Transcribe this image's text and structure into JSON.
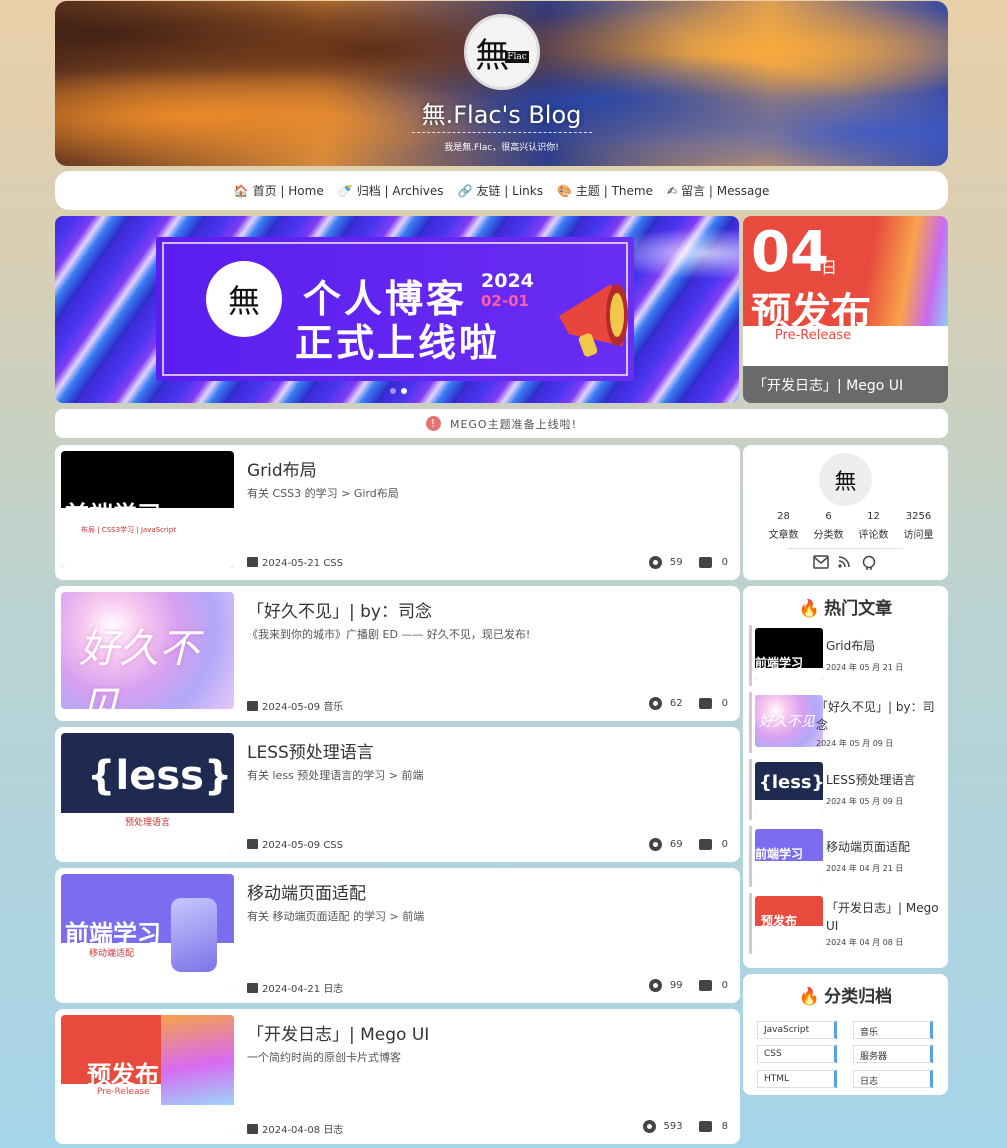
{
  "header": {
    "title": "無.Flac's Blog",
    "subtitle": "我是無.Flac，很高兴认识你!",
    "avatar_text": "無",
    "avatar_badge": "Flac"
  },
  "nav": [
    {
      "icon": "🏠",
      "label": "首页 | Home"
    },
    {
      "icon": "🍼",
      "label": "归档 | Archives"
    },
    {
      "icon": "🔗",
      "label": "友链 | Links"
    },
    {
      "icon": "🎨",
      "label": "主题 | Theme"
    },
    {
      "icon": "✍",
      "label": "留言 | Message"
    }
  ],
  "banner": {
    "logo": "無",
    "line1": "个人博客",
    "line2": "正式上线啦",
    "year": "2024",
    "date": "02-01"
  },
  "feature": {
    "day": "04",
    "day_unit": "日",
    "big": "预发布",
    "sub": "Pre-Release",
    "caption": "「开发日志」| Mego UI"
  },
  "notice": {
    "text": "MEGO主题准备上线啦!",
    "icon": "!"
  },
  "posts": [
    {
      "title": "Grid布局",
      "desc": "有关 CSS3 的学习 > Gird布局",
      "date": "2024-05-21",
      "cat": "CSS",
      "views": "59",
      "comments": "0",
      "thumb_text": "前端学习",
      "thumb_sub": "布局 | CSS3学习 | JavaScript"
    },
    {
      "title": "「好久不见」| by：司念",
      "desc": "《我来到你的城市》广播剧 ED —— 好久不见，现已发布!",
      "date": "2024-05-09",
      "cat": "音乐",
      "views": "62",
      "comments": "0",
      "thumb_text": "好久不见",
      "thumb_sub": ""
    },
    {
      "title": "LESS预处理语言",
      "desc": "有关 less 预处理语言的学习 > 前端",
      "date": "2024-05-09",
      "cat": "CSS",
      "views": "69",
      "comments": "0",
      "thumb_text": "{less}",
      "thumb_sub": "预处理语言"
    },
    {
      "title": "移动端页面适配",
      "desc": "有关 移动端页面适配 的学习 > 前端",
      "date": "2024-04-21",
      "cat": "日志",
      "views": "99",
      "comments": "0",
      "thumb_text": "前端学习",
      "thumb_sub": "移动端适配"
    },
    {
      "title": "「开发日志」| Mego UI",
      "desc": "一个简约时尚的原创卡片式博客",
      "date": "2024-04-08",
      "cat": "日志",
      "views": "593",
      "comments": "8",
      "thumb_text": "预发布",
      "thumb_sub": "Pre-Release"
    }
  ],
  "profile": {
    "avatar_text": "無",
    "stats": [
      {
        "num": "28",
        "label": "文章数"
      },
      {
        "num": "6",
        "label": "分类数"
      },
      {
        "num": "12",
        "label": "评论数"
      },
      {
        "num": "3256",
        "label": "访问量"
      }
    ],
    "icons": [
      "mail-icon",
      "rss-icon",
      "github-icon"
    ]
  },
  "hot": {
    "title": "热门文章",
    "items": [
      {
        "title": "Grid布局",
        "date": "2024 年 05 月 21 日",
        "thumb_text": "前端学习"
      },
      {
        "title": "「好久不见」| by：司念",
        "date": "2024 年 05 月 09 日",
        "thumb_text": "好久不见"
      },
      {
        "title": "LESS预处理语言",
        "date": "2024 年 05 月 09 日",
        "thumb_text": "{less}"
      },
      {
        "title": "移动端页面适配",
        "date": "2024 年 04 月 21 日",
        "thumb_text": "前端学习"
      },
      {
        "title": "「开发日志」| Mego UI",
        "date": "2024 年 04 月 08 日",
        "thumb_text": "预发布"
      }
    ]
  },
  "archive": {
    "title": "分类归档",
    "tags": [
      "JavaScript",
      "音乐",
      "CSS",
      "服务器",
      "HTML",
      "日志"
    ]
  },
  "colors": {
    "accent": "#e84a3e",
    "fire": "#e85a3a",
    "tag_border": "#5aa0e8"
  }
}
